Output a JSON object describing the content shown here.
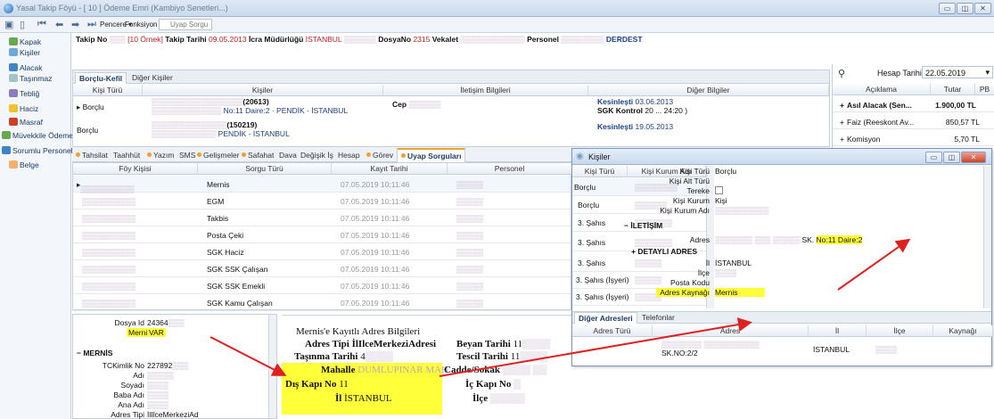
{
  "window": {
    "title": "Yasal Takip Föyü - [ 10 ] Ödeme Emri (Kambiyo Senetleri...)",
    "btn_min": "▭",
    "btn_max": "◫",
    "btn_close": "✕"
  },
  "toolbar": {
    "pencere": "Pencere ▾",
    "fonksiyon": "Fonksiyon ▾",
    "search_placeholder": "Uyap Sorgu"
  },
  "leftnav": {
    "items": [
      {
        "label": "Kapak",
        "color": "#6aa84f"
      },
      {
        "label": "Kişiler",
        "color": "#6fa8dc"
      },
      {
        "label": "Alacak",
        "color": "#3d85c6"
      },
      {
        "label": "Taşınmaz",
        "color": "#a2c4c9"
      },
      {
        "label": "Tebliğ",
        "color": "#8e7cc3"
      },
      {
        "label": "Haciz",
        "color": "#f1c232"
      },
      {
        "label": "Masraf",
        "color": "#cc4125"
      },
      {
        "label": "Müvekkile Ödeme",
        "color": "#6aa84f"
      },
      {
        "label": "Sorumlu Personel",
        "color": "#3d85c6"
      },
      {
        "label": "Belge",
        "color": "#f6b26b"
      }
    ]
  },
  "info": {
    "takip_no_label": "Takip No",
    "takip_no": "10 Örnek",
    "takip_tarihi_label": "Takip Tarihi",
    "takip_tarihi": "09.05.2013",
    "icra_label": "İcra Müdürlüğü",
    "icra": "İSTANBUL",
    "dosyano_label": "DosyaNo",
    "dosyano": "2315",
    "vekalet_label": "Vekalet",
    "personel_label": "Personel",
    "durum": "DERDEST"
  },
  "borclu": {
    "tab_active": "Borçlu-Kefil",
    "tab_other": "Diğer Kişiler",
    "headers": [
      "Kişi Türü",
      "Kişiler",
      "İletişim Bilgileri",
      "Diğer Bilgiler"
    ],
    "rows": [
      {
        "tur": "Borçlu",
        "kisi_line1": "(20613)",
        "kisi_line2": "No:11 Daire:2 · PENDİK - İSTANBUL",
        "iletisim": "Cep",
        "diger1_label": "Kesinleşti",
        "diger1": "03.06.2013",
        "diger2_label": "SGK Kontrol",
        "diger2": "20 ... 24:20 )"
      },
      {
        "tur": "Borçlu",
        "kisi_line1": "(150219)",
        "kisi_line2": "PENDİK - İSTANBUL",
        "iletisim": "",
        "diger1_label": "Kesinleşti",
        "diger1": "19.05.2013",
        "diger2_label": "",
        "diger2": ""
      }
    ]
  },
  "summary": {
    "hesap_tarihi_label": "Hesap Tarihi",
    "hesap_tarihi": "22.05.2019",
    "headers": [
      "Açıklama",
      "Tutar",
      "PB"
    ],
    "rows": [
      {
        "aciklama": "Asıl Alacak (Sen...",
        "tutar": "1.900,00 TL",
        "bold": true
      },
      {
        "aciklama": "Faiz (Reeskont Av...",
        "tutar": "850,57 TL",
        "bold": false
      },
      {
        "aciklama": "Komisyon",
        "tutar": "5,70 TL",
        "bold": false
      }
    ]
  },
  "lowertabs": [
    {
      "label": "Tahsilat",
      "dot": true
    },
    {
      "label": "Taahhüt",
      "dot": false
    },
    {
      "label": "Yazım",
      "dot": true
    },
    {
      "label": "SMS",
      "dot": false
    },
    {
      "label": "Gelişmeler",
      "dot": true
    },
    {
      "label": "Safahat",
      "dot": true
    },
    {
      "label": "Dava",
      "dot": false
    },
    {
      "label": "Değişik İş",
      "dot": false
    },
    {
      "label": "Hesap",
      "dot": false
    },
    {
      "label": "Görev",
      "dot": true
    },
    {
      "label": "Uyap Sorguları",
      "dot": true,
      "active": true
    }
  ],
  "uyap": {
    "headers": [
      "Föy Kişisi",
      "Sorgu Türü",
      "Kayıt Tarihi",
      "Personel"
    ],
    "rows": [
      {
        "kisi": "",
        "sorgu": "Mernis",
        "tarih": "07.05.2019 10:11:46",
        "personel": ""
      },
      {
        "kisi": "",
        "sorgu": "EGM",
        "tarih": "07.05.2019 10:11:46",
        "personel": ""
      },
      {
        "kisi": "",
        "sorgu": "Takbis",
        "tarih": "07.05.2019 10:11:46",
        "personel": ""
      },
      {
        "kisi": "",
        "sorgu": "Posta Çeki",
        "tarih": "07.05.2019 10:11:46",
        "personel": ""
      },
      {
        "kisi": "",
        "sorgu": "SGK Haciz",
        "tarih": "07.05.2019 10:11:46",
        "personel": ""
      },
      {
        "kisi": "",
        "sorgu": "SGK SSK Çalışan",
        "tarih": "07.05.2019 10:11:46",
        "personel": ""
      },
      {
        "kisi": "",
        "sorgu": "SGK SSK Emekli",
        "tarih": "07.05.2019 10:11:46",
        "personel": ""
      },
      {
        "kisi": "",
        "sorgu": "SGK Kamu Çalışan",
        "tarih": "07.05.2019 10:11:46",
        "personel": ""
      }
    ]
  },
  "kisiler": {
    "title": "Kişiler",
    "list_headers": [
      "Kişi Türü",
      "Kişi Kurum Adı"
    ],
    "list": [
      "Borçlu",
      "Borçlu",
      "3. Şahıs",
      "3. Şahıs",
      "3. Şahıs",
      "3. Şahıs (İşyeri)",
      "3. Şahıs (İşyeri)"
    ],
    "props": {
      "kisi_turu_label": "Kişi Türü",
      "kisi_turu": "Borçlu",
      "kisi_alt_turu_label": "Kişi Alt Türü",
      "tereke_label": "Tereke",
      "kisi_kurum_label": "Kişi Kurum",
      "kisi_kurum": "Kişi",
      "kisi_kurum_adi_label": "Kişi Kurum Adı",
      "iletisim_label": "İLETİŞİM",
      "adres_label": "Adres",
      "adres_highlight": "No:11 Daire:2",
      "adres_prefix": "SK.",
      "detayli_label": "DETAYLI ADRES",
      "il_label": "İl",
      "il": "İSTANBUL",
      "ilce_label": "İlçe",
      "posta_kodu_label": "Posta Kodu",
      "adres_kaynagi_label": "Adres Kaynağı",
      "adres_kaynagi": "Mernis"
    },
    "tabs": [
      "Diğer Adresleri",
      "Telefonlar"
    ],
    "addr_headers": [
      "Adres Türü",
      "Adres",
      "İl",
      "İlçe",
      "Kaynağı"
    ],
    "addr_row": {
      "adres_tail": "SK.NO:2/2",
      "il": "İSTANBUL"
    }
  },
  "details": {
    "dosya_id_label": "Dosya Id",
    "dosya_id": "24364",
    "mernis_label": "Mernis",
    "mernis": "VAR",
    "section": "MERNİS",
    "tckimlik_label": "TCKimlik No",
    "tckimlik": "227892",
    "adi_label": "Adı",
    "soyadi_label": "Soyadı",
    "baba_label": "Baba Adı",
    "ana_label": "Ana Adı",
    "adres_tipi_label": "Adres Tipi",
    "adres_tipi": "İlIlceMerkeziAd"
  },
  "doc": {
    "title": "Mernis'e Kayıtlı Adres Bilgileri",
    "adres_tipi": "Adres Tipi İlIlceMerkeziAdresi",
    "beyan_label": "Beyan Tarihi",
    "beyan": "11",
    "tasinma_label": "Taşınma Tarihi",
    "tasinma": "4",
    "tescil_label": "Tescil Tarihi",
    "tescil": "11",
    "mahalle_label": "Mahalle",
    "mahalle": "DUMLUPINAR MAH",
    "cadde_label": "Cadde/Sokak",
    "dis_kapi_label": "Dış Kapı No",
    "dis_kapi": "11",
    "ic_kapi_label": "İç Kapı No",
    "il_label": "İl",
    "il": "İSTANBUL",
    "ilce_label": "İlçe"
  }
}
